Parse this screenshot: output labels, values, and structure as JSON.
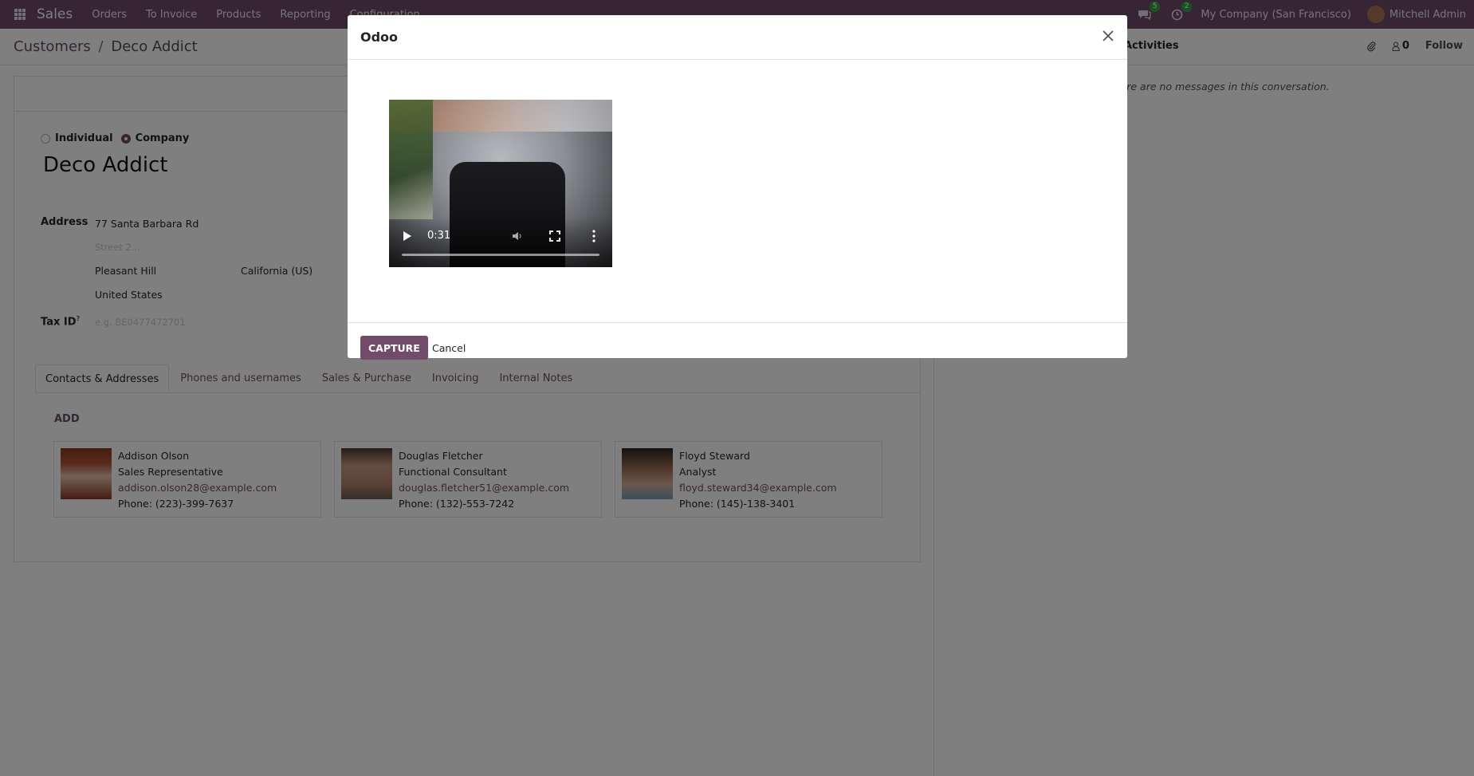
{
  "navbar": {
    "app_name": "Sales",
    "menu": [
      "Orders",
      "To Invoice",
      "Products",
      "Reporting",
      "Configuration"
    ],
    "messages_count": "5",
    "activities_count": "2",
    "company": "My Company (San Francisco)",
    "user": "Mitchell Admin"
  },
  "breadcrumb": {
    "parent": "Customers",
    "separator": "/",
    "current": "Deco Addict"
  },
  "control_panel": {
    "activities_label": "Activities",
    "followers_count": "0",
    "follow_label": "Follow"
  },
  "form": {
    "type_individual": "Individual",
    "type_company": "Company",
    "selected_type": "Company",
    "name": "Deco Addict",
    "address_label": "Address",
    "street": "77 Santa Barbara Rd",
    "street2_placeholder": "Street 2...",
    "city": "Pleasant Hill",
    "state": "California (US)",
    "country": "United States",
    "tax_id_label": "Tax ID",
    "tax_id_help": "?",
    "tax_id_placeholder": "e.g. BE0477472701"
  },
  "tabs": [
    {
      "label": "Contacts & Addresses",
      "active": true
    },
    {
      "label": "Phones and usernames",
      "active": false
    },
    {
      "label": "Sales & Purchase",
      "active": false
    },
    {
      "label": "Invoicing",
      "active": false
    },
    {
      "label": "Internal Notes",
      "active": false
    }
  ],
  "contacts": {
    "add_label": "ADD",
    "items": [
      {
        "name": "Addison Olson",
        "title": "Sales Representative",
        "email": "addison.olson28@example.com",
        "phone": "Phone: (223)-399-7637"
      },
      {
        "name": "Douglas Fletcher",
        "title": "Functional Consultant",
        "email": "douglas.fletcher51@example.com",
        "phone": "Phone: (132)-553-7242"
      },
      {
        "name": "Floyd Steward",
        "title": "Analyst",
        "email": "floyd.steward34@example.com",
        "phone": "Phone: (145)-138-3401"
      }
    ]
  },
  "chatter": {
    "no_messages": "There are no messages in this conversation."
  },
  "modal": {
    "title": "Odoo",
    "video_time": "0:31",
    "capture_label": "CAPTURE",
    "cancel_label": "Cancel"
  },
  "colors": {
    "brand": "#714b67",
    "badge": "#28a745"
  }
}
